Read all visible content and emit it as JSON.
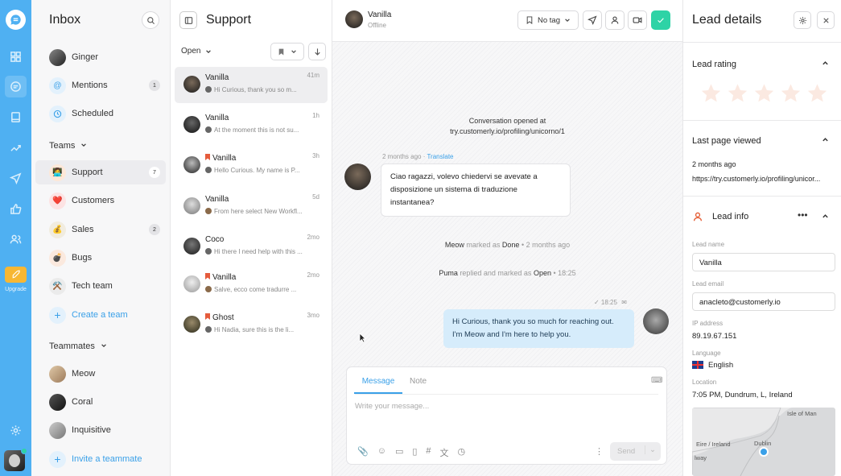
{
  "rail": {
    "upgrade_label": "Upgrade"
  },
  "inbox": {
    "title": "Inbox",
    "items": [
      {
        "label": "Ginger"
      },
      {
        "label": "Mentions",
        "count": "1"
      },
      {
        "label": "Scheduled"
      }
    ],
    "teams_header": "Teams",
    "teams": [
      {
        "label": "Support",
        "count": "7"
      },
      {
        "label": "Customers"
      },
      {
        "label": "Sales",
        "count": "2"
      },
      {
        "label": "Bugs"
      },
      {
        "label": "Tech team"
      }
    ],
    "create_team": "Create a team",
    "teammates_header": "Teammates",
    "teammates": [
      {
        "label": "Meow"
      },
      {
        "label": "Coral"
      },
      {
        "label": "Inquisitive"
      }
    ],
    "invite": "Invite a teammate"
  },
  "list": {
    "title": "Support",
    "filter": "Open",
    "conversations": [
      {
        "name": "Vanilla",
        "time": "41m",
        "preview": "Hi Curious, thank you so m..."
      },
      {
        "name": "Vanilla",
        "time": "1h",
        "preview": "At the moment this is not su..."
      },
      {
        "name": "Vanilla",
        "time": "3h",
        "preview": "Hello Curious. My name is P..."
      },
      {
        "name": "Vanilla",
        "time": "5d",
        "preview": "From here select New Workfl..."
      },
      {
        "name": "Coco",
        "time": "2mo",
        "preview": "Hi there I need help with this ..."
      },
      {
        "name": "Vanilla",
        "time": "2mo",
        "preview": "Salve, ecco come tradurre ..."
      },
      {
        "name": "Ghost",
        "time": "3mo",
        "preview": "Hi Nadia, sure this is the li..."
      }
    ]
  },
  "chat": {
    "contact_name": "Vanilla",
    "contact_status": "Offline",
    "tag": "No tag",
    "opened_line1": "Conversation opened at",
    "opened_line2": "try.customerly.io/profiling/unicorno/1",
    "msg1_meta_time": "2 months ago",
    "msg1_meta_translate": "Translate",
    "msg1_text": "Ciao ragazzi, volevo chiedervi se avevate a disposizione un sistema di traduzione instantanea?",
    "sys1_actor": "Meow",
    "sys1_mid": "marked as",
    "sys1_state": "Done",
    "sys1_time": "• 2 months ago",
    "sys2_actor": "Puma",
    "sys2_mid": "replied and marked as",
    "sys2_state": "Open",
    "sys2_time": "• 18:25",
    "msg2_time": "✓ 18:25",
    "msg2_text": "Hi Curious, thank you so much for reaching out. I'm Meow and I'm here to help you.",
    "composer_tab_message": "Message",
    "composer_tab_note": "Note",
    "composer_placeholder": "Write your message...",
    "send_label": "Send"
  },
  "lead": {
    "title": "Lead details",
    "rating_title": "Lead rating",
    "rating_value": 0,
    "rating_max": 5,
    "last_page_title": "Last page viewed",
    "last_page_time": "2 months ago",
    "last_page_url": "https://try.customerly.io/profiling/unicor...",
    "info_title": "Lead info",
    "name_label": "Lead name",
    "name_value": "Vanilla",
    "email_label": "Lead email",
    "email_value": "anacleto@customerly.io",
    "ip_label": "IP address",
    "ip_value": "89.19.67.151",
    "language_label": "Language",
    "language_value": "English",
    "location_label": "Location",
    "location_value": "7:05 PM, Dundrum, L, Ireland",
    "map_labels": [
      "Isle of Man",
      "Eire / Ireland",
      "Dublin",
      "lway"
    ]
  },
  "colors": {
    "rail": "#4fb0f2",
    "accent": "#3aa0e8",
    "done_green": "#2ed3a6",
    "upgrade": "#f7b733",
    "flag": "#e55b3c"
  }
}
